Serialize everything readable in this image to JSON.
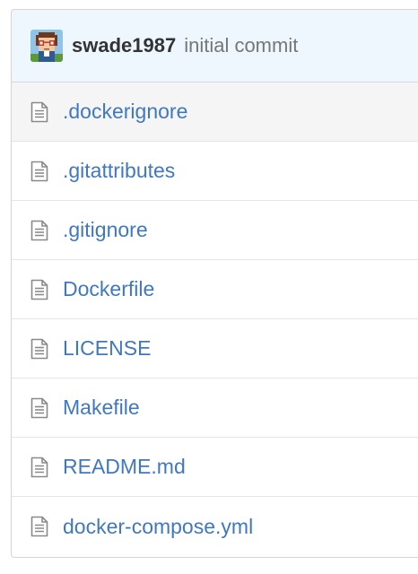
{
  "commit": {
    "author": "swade1987",
    "message": "initial commit",
    "avatar_icon": "pixel-avatar-glasses"
  },
  "files": [
    {
      "name": ".dockerignore",
      "icon": "file-text-icon"
    },
    {
      "name": ".gitattributes",
      "icon": "file-text-icon"
    },
    {
      "name": ".gitignore",
      "icon": "file-text-icon"
    },
    {
      "name": "Dockerfile",
      "icon": "file-text-icon"
    },
    {
      "name": "LICENSE",
      "icon": "file-text-icon"
    },
    {
      "name": "Makefile",
      "icon": "file-text-icon"
    },
    {
      "name": "README.md",
      "icon": "file-text-icon"
    },
    {
      "name": "docker-compose.yml",
      "icon": "file-text-icon"
    }
  ],
  "colors": {
    "link": "#4078c0",
    "header_bg": "#eef7fd",
    "hover_row_bg": "#f5f5f5"
  }
}
